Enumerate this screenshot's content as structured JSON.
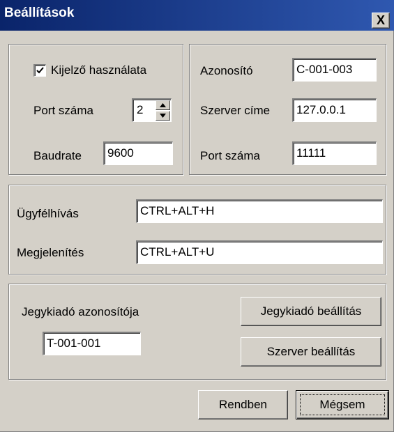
{
  "window": {
    "title": "Beállítások",
    "close_label": "X"
  },
  "display_group": {
    "use_display_label": "Kijelző használata",
    "use_display_checked": true,
    "port_label": "Port száma",
    "port_value": "2",
    "baudrate_label": "Baudrate",
    "baudrate_value": "9600"
  },
  "server_group": {
    "id_label": "Azonosító",
    "id_value": "C-001-003",
    "address_label": "Szerver címe",
    "address_value": "127.0.0.1",
    "port_label": "Port száma",
    "port_value": "11111"
  },
  "hotkeys_group": {
    "customer_call_label": "Ügyfélhívás",
    "customer_call_value": "CTRL+ALT+H",
    "display_label": "Megjelenítés",
    "display_value": "CTRL+ALT+U"
  },
  "ticket_group": {
    "ticket_id_label": "Jegykiadó azonosítója",
    "ticket_id_value": "T-001-001",
    "ticket_settings_button": "Jegykiadó beállítás",
    "server_settings_button": "Szerver beállítás"
  },
  "footer": {
    "ok_button": "Rendben",
    "cancel_button": "Mégsem"
  },
  "colors": {
    "title_bar_start": "#0a246a",
    "title_bar_end": "#2f58b0",
    "face": "#d4d0c8"
  }
}
